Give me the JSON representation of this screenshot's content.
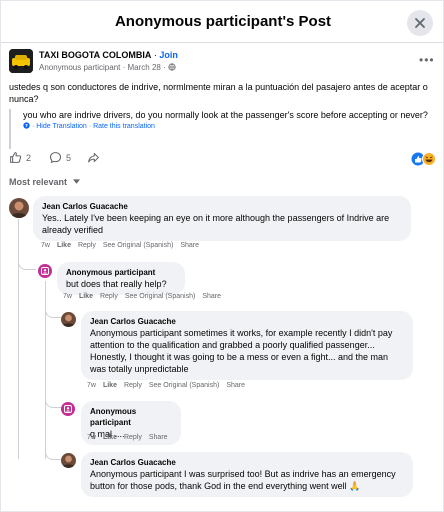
{
  "header": {
    "title": "Anonymous participant's Post"
  },
  "post": {
    "page_name": "TAXI BOGOTA COLOMBIA",
    "separator": " · ",
    "join_label": "Join",
    "author": "Anonymous participant",
    "date": "March 28",
    "original_text": "ustedes q son conductores de indrive, normlmente miran a la puntuación del pasajero antes de aceptar o nunca?",
    "translated_text": "you who are indrive drivers, do you normally look at the passenger's score before accepting or never?",
    "hide_translation": "Hide Translation",
    "rate_translation": "Rate this translation",
    "like_count": "2",
    "comment_count": "5"
  },
  "sort": {
    "label": "Most relevant"
  },
  "comments": [
    {
      "author": "Jean Carlos Guacache",
      "text": "Yes.. Lately I've been keeping an eye on it more although the passengers of Indrive are already verified",
      "time": "7w",
      "like": "Like",
      "reply": "Reply",
      "see_original": "See Original (Spanish)",
      "share": "Share"
    },
    {
      "author": "Anonymous participant",
      "text": "but does that really help?",
      "time": "7w",
      "like": "Like",
      "reply": "Reply",
      "see_original": "See Original (Spanish)",
      "share": "Share"
    },
    {
      "author": "Jean Carlos Guacache",
      "text": "Anonymous participant sometimes it works, for example recently I didn't pay attention to the qualification and grabbed a poorly qualified passenger... Honestly, I thought it was going to be a mess or even a fight... and the man was totally unpredictable",
      "time": "7w",
      "like": "Like",
      "reply": "Reply",
      "see_original": "See Original (Spanish)",
      "share": "Share"
    },
    {
      "author": "Anonymous participant",
      "text": "q mal ....",
      "time": "7w",
      "like": "Like",
      "reply": "Reply",
      "share": "Share"
    },
    {
      "author": "Jean Carlos Guacache",
      "text": "Anonymous participant I was surprised too! But as indrive has an emergency button for those pods, thank God in the end everything went well 🙏"
    }
  ],
  "colors": {
    "accent": "#0866ff",
    "anon": "#c22f96",
    "bubble": "#f0f2f5"
  }
}
